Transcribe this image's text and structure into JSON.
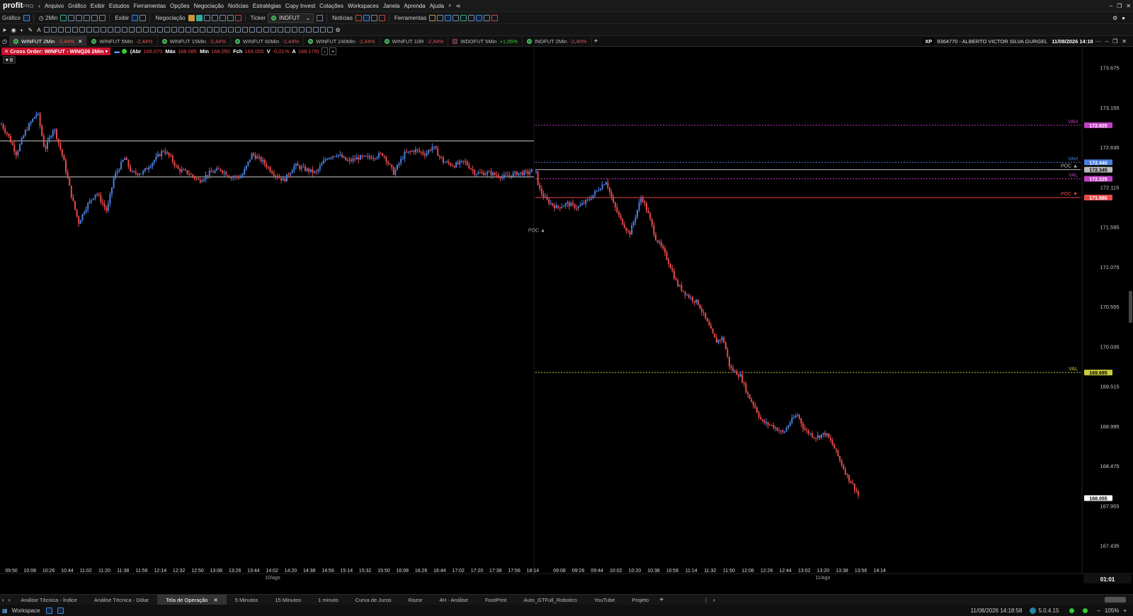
{
  "app": {
    "logo": "profit",
    "logo_suffix": "PRO"
  },
  "menu": [
    "Arquivo",
    "Gráfico",
    "Exibir",
    "Estudos",
    "Ferramentas",
    "Opções",
    "Negociação",
    "Notícias",
    "Estratégias",
    "Copy Invest",
    "Cotações",
    "Workspaces",
    "Janela",
    "Aprenda",
    "Ajuda"
  ],
  "toolbar": {
    "grafico_label": "Gráfico",
    "timeframe": "2Min",
    "exibir_label": "Exibir",
    "negociacao_label": "Negociação",
    "ticker_label": "Ticker",
    "ticker_value": "INDFUT",
    "noticias_label": "Notícias",
    "ferramentas_label": "Ferramentas"
  },
  "chart_tabs": [
    {
      "label": "WINFUT 2Min",
      "pct": "-2,44%",
      "active": true
    },
    {
      "label": "WINFUT 5Min",
      "pct": "-2,44%"
    },
    {
      "label": "WINFUT 15Min",
      "pct": "-2,44%"
    },
    {
      "label": "WINFUT 60Min",
      "pct": "-2,44%"
    },
    {
      "label": "WINFUT 240Min",
      "pct": "-2,44%"
    },
    {
      "label": "WINFUT 10R",
      "pct": "-2,44%"
    },
    {
      "label": "WDOFUT 5Min",
      "pct": "+1,05%",
      "up": true,
      "flag": "us"
    },
    {
      "label": "INDFUT 2Min",
      "pct": "-2,40%"
    }
  ],
  "account": {
    "broker": "XP",
    "id": "9364770 - ALBERTO VICTOR SILVA GURGEL",
    "datetime": "11/08/2026 14:18"
  },
  "header": {
    "cross_order": "Cross Order: WINFUT - WINQ26 2Min",
    "abr_label": "(Abr",
    "abr": "168.070",
    "max_label": "Máx",
    "max": "168.085",
    "min_label": "Min",
    "min": "168.050",
    "fch_label": "Fch",
    "fch": "168.055",
    "v_label": "V",
    "v": "-0,01%",
    "a_label": "A",
    "a": "168.179)",
    "indicator_count": "8"
  },
  "colors": {
    "up": "#4a7fe0",
    "down": "#e84a4a",
    "vah_top": "#c040c0",
    "vah_blue": "#4a7fe0",
    "poc": "#bbbbbb",
    "val_mag": "#c040c0",
    "poc_red": "#e84a4a",
    "val_yellow": "#c9c93a",
    "white_line": "#cfcfcf"
  },
  "chart_data": {
    "type": "candlestick",
    "ylim": [
      167.2,
      173.95
    ],
    "yticks": [
      "173.675",
      "173.155",
      "172.635",
      "172.115",
      "171.595",
      "171.075",
      "170.555",
      "170.035",
      "169.515",
      "168.995",
      "168.475",
      "167.955",
      "167.435"
    ],
    "ytick_values": [
      173.675,
      173.155,
      172.635,
      172.115,
      171.595,
      171.075,
      170.555,
      170.035,
      169.515,
      168.995,
      168.475,
      167.955,
      167.435
    ],
    "xticks_day1": [
      "09:50",
      "10:08",
      "10:26",
      "10:44",
      "11:02",
      "11:20",
      "11:38",
      "11:56",
      "12:14",
      "12:32",
      "12:50",
      "13:08",
      "13:26",
      "13:44",
      "14:02",
      "14:20",
      "14:38",
      "14:56",
      "15:14",
      "15:32",
      "15:50",
      "16:08",
      "16:26",
      "16:44",
      "17:02",
      "17:20",
      "17:38",
      "17:56",
      "18:14"
    ],
    "xticks_day2": [
      "09:08",
      "09:26",
      "09:44",
      "10:02",
      "10:20",
      "10:38",
      "10:56",
      "11:14",
      "11:32",
      "11:50",
      "12:08",
      "12:26",
      "12:44",
      "13:02",
      "13:20",
      "13:38",
      "13:56",
      "14:14"
    ],
    "day_labels": [
      "10/ago",
      "11/ago"
    ],
    "day1_path": [
      [
        0,
        172.95
      ],
      [
        10,
        172.8
      ],
      [
        22,
        172.55
      ],
      [
        35,
        172.85
      ],
      [
        52,
        173.1
      ],
      [
        62,
        172.6
      ],
      [
        75,
        172.9
      ],
      [
        88,
        172.5
      ],
      [
        100,
        172.0
      ],
      [
        110,
        171.65
      ],
      [
        120,
        171.85
      ],
      [
        135,
        172.05
      ],
      [
        150,
        171.8
      ],
      [
        160,
        172.25
      ],
      [
        175,
        172.5
      ],
      [
        185,
        172.3
      ],
      [
        200,
        172.3
      ],
      [
        215,
        172.45
      ],
      [
        230,
        172.6
      ],
      [
        240,
        172.5
      ],
      [
        250,
        172.35
      ],
      [
        265,
        172.3
      ],
      [
        280,
        172.2
      ],
      [
        295,
        172.3
      ],
      [
        310,
        172.35
      ],
      [
        325,
        172.25
      ],
      [
        340,
        172.25
      ],
      [
        355,
        172.55
      ],
      [
        370,
        172.45
      ],
      [
        385,
        172.3
      ],
      [
        400,
        172.2
      ],
      [
        415,
        172.4
      ],
      [
        430,
        172.35
      ],
      [
        445,
        172.3
      ],
      [
        460,
        172.5
      ],
      [
        475,
        172.55
      ],
      [
        490,
        172.45
      ],
      [
        505,
        172.5
      ],
      [
        520,
        172.5
      ],
      [
        540,
        172.55
      ],
      [
        555,
        172.3
      ],
      [
        570,
        172.55
      ],
      [
        585,
        172.6
      ],
      [
        600,
        172.55
      ],
      [
        610,
        172.65
      ],
      [
        625,
        172.45
      ],
      [
        640,
        172.4
      ],
      [
        655,
        172.45
      ],
      [
        670,
        172.3
      ],
      [
        690,
        172.3
      ],
      [
        710,
        172.25
      ],
      [
        730,
        172.3
      ],
      [
        745,
        172.3
      ],
      [
        752,
        172.35
      ]
    ],
    "day2_path": [
      [
        756,
        172.3
      ],
      [
        760,
        172.1
      ],
      [
        770,
        171.95
      ],
      [
        785,
        171.85
      ],
      [
        800,
        171.9
      ],
      [
        815,
        171.85
      ],
      [
        830,
        171.95
      ],
      [
        845,
        172.1
      ],
      [
        855,
        172.2
      ],
      [
        865,
        171.9
      ],
      [
        875,
        171.7
      ],
      [
        888,
        171.5
      ],
      [
        895,
        171.7
      ],
      [
        905,
        172.0
      ],
      [
        915,
        171.75
      ],
      [
        925,
        171.45
      ],
      [
        935,
        171.3
      ],
      [
        945,
        171.1
      ],
      [
        955,
        170.85
      ],
      [
        970,
        170.7
      ],
      [
        985,
        170.6
      ],
      [
        1000,
        170.3
      ],
      [
        1010,
        170.1
      ],
      [
        1020,
        170.15
      ],
      [
        1030,
        169.75
      ],
      [
        1045,
        169.65
      ],
      [
        1055,
        169.4
      ],
      [
        1065,
        169.25
      ],
      [
        1075,
        169.05
      ],
      [
        1090,
        169.0
      ],
      [
        1105,
        168.9
      ],
      [
        1115,
        169.05
      ],
      [
        1125,
        169.15
      ],
      [
        1135,
        168.95
      ],
      [
        1150,
        168.85
      ],
      [
        1165,
        168.9
      ],
      [
        1175,
        168.75
      ],
      [
        1185,
        168.55
      ],
      [
        1195,
        168.35
      ],
      [
        1205,
        168.2
      ],
      [
        1213,
        168.06
      ]
    ],
    "levels": [
      {
        "label": "VAH",
        "value": 172.925,
        "price": "172.925",
        "color": "#c040c0",
        "style": "dotted",
        "x_from": 756
      },
      {
        "label": "VAH",
        "value": 172.44,
        "price": "172.440",
        "color": "#4a7fe0",
        "style": "dotted",
        "x_from": 756
      },
      {
        "label": "POC ▲",
        "value": 172.345,
        "price": "172.345",
        "color": "#bbbbbb",
        "style": "solid",
        "x_from": 756
      },
      {
        "label": "VAL",
        "value": 172.225,
        "price": "172.225",
        "color": "#c040c0",
        "style": "dotted",
        "x_from": 756
      },
      {
        "label": "POC ▼",
        "value": 171.98,
        "price": "171.980",
        "color": "#e84a4a",
        "style": "solid",
        "x_from": 756
      },
      {
        "label": "VAL",
        "value": 169.695,
        "price": "169.695",
        "color": "#c9c93a",
        "style": "dotted",
        "x_from": 756
      }
    ],
    "white_lines": [
      172.72,
      172.25
    ],
    "poc_marker": {
      "label": "POC ▲",
      "value": 171.56
    },
    "last_price": {
      "value": 168.055,
      "price": "168.055"
    },
    "countdown": "01:01"
  },
  "bottom_tabs": [
    "Análise Técnica - Índice",
    "Análise Técnica - Dólar",
    "Tela de Operação",
    "5 Minutos",
    "15 Minutos",
    "1 minuto",
    "Curva de Juros",
    "Razor",
    "4H - Análise",
    "FootPrint",
    "Auto_GTFull_Robotics",
    "YouTube",
    "Projeto"
  ],
  "active_bottom_tab": 2,
  "status": {
    "workspace": "Workspace",
    "datetime": "11/08/2026 14:18:58",
    "version": "5.0.4.15",
    "zoom": "105%"
  }
}
